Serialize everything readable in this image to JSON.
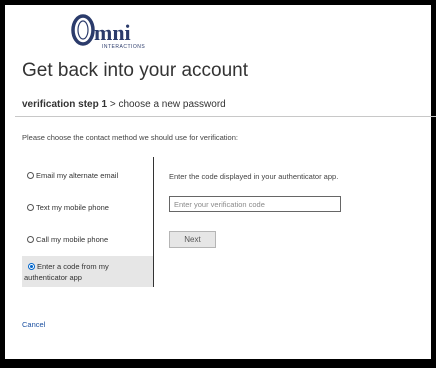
{
  "logo": {
    "word": "mni",
    "initial": "O",
    "tagline": "INTERACTIONS",
    "color": "#2b3b6b"
  },
  "title": "Get back into your account",
  "steps": {
    "current": "verification step 1",
    "separator": ">",
    "next": "choose a new password"
  },
  "prompt": "Please choose the contact method we should use for verification:",
  "options": [
    {
      "label": "Email my alternate email",
      "selected": false
    },
    {
      "label": "Text my mobile phone",
      "selected": false
    },
    {
      "label": "Call my mobile phone",
      "selected": false
    },
    {
      "label_line1": "Enter a code from my",
      "label_line2": "authenticator app",
      "selected": true
    }
  ],
  "right_panel": {
    "description": "Enter the code displayed in your authenticator app.",
    "input_placeholder": "Enter your verification code",
    "input_value": "",
    "next_label": "Next"
  },
  "cancel_label": "Cancel",
  "colors": {
    "link": "#1a4fa0",
    "radio_selected": "#0066cc",
    "selected_bg": "#e6e6e6"
  }
}
